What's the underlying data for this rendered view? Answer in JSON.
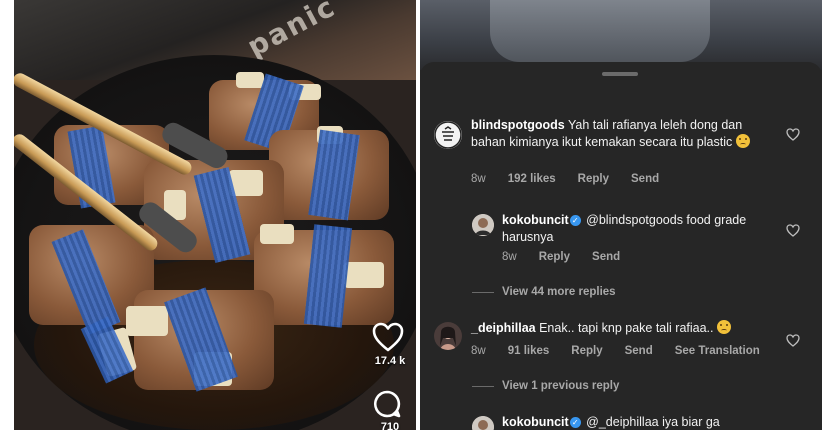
{
  "left": {
    "brand_text": "panic",
    "likes_count": "17.4 k",
    "comments_count": "710",
    "icons": [
      "heart-icon",
      "comment-icon"
    ]
  },
  "right": {
    "comments": [
      {
        "username": "blindspotgoods",
        "verified": false,
        "text": "Yah tali rafianya leleh dong dan bahan kimianya ikut kemakan secara itu plastic",
        "emoji": "sad-face",
        "age": "8w",
        "likes": "192 likes",
        "reply": "Reply",
        "send": "Send"
      },
      {
        "username": "kokobuncit",
        "verified": true,
        "text": "@blindspotgoods food grade harusnya",
        "age": "8w",
        "reply": "Reply",
        "send": "Send"
      },
      {
        "username": "_deiphillaa",
        "verified": false,
        "text": "Enak.. tapi knp pake tali rafiaa..",
        "emoji": "sad-face",
        "age": "8w",
        "likes": "91 likes",
        "reply": "Reply",
        "send": "Send",
        "translation": "See Translation"
      },
      {
        "username": "kokobuncit",
        "verified": true,
        "text": "@_deiphillaa iya biar ga"
      }
    ],
    "view_more_replies": "View 44 more replies",
    "view_previous_reply": "View 1 previous reply"
  },
  "colors": {
    "sheet_bg": "#262626",
    "text_primary": "#f2f2f2",
    "text_secondary": "#a8a8a8",
    "verified_blue": "#3897f0",
    "rope_blue": "#2a57a8"
  }
}
